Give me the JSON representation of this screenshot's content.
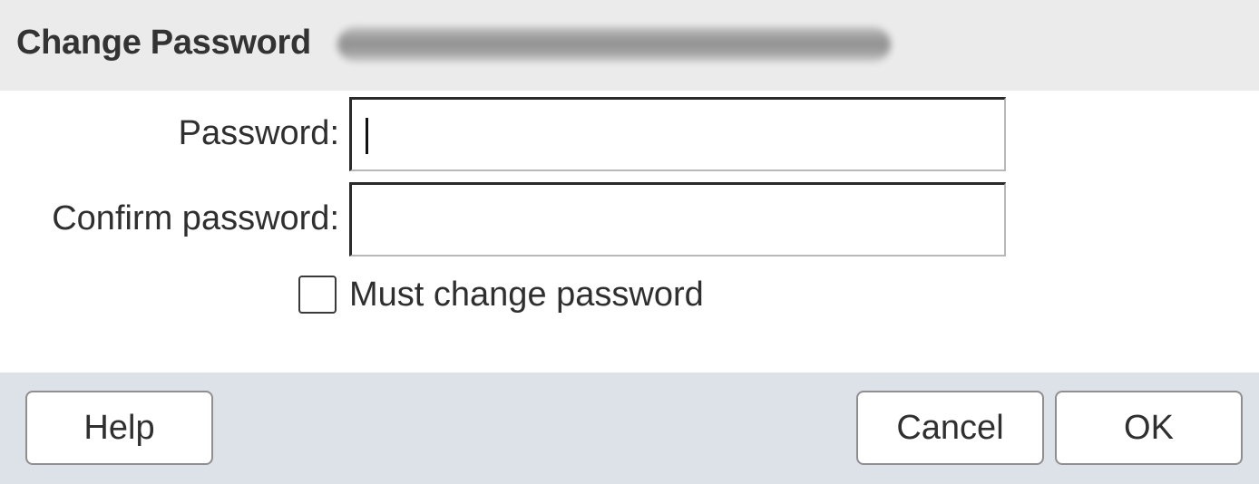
{
  "dialog": {
    "title": "Change Password",
    "title_redacted": true
  },
  "form": {
    "password": {
      "label": "Password:",
      "value": "",
      "placeholder": ""
    },
    "confirm_password": {
      "label": "Confirm password:",
      "value": "",
      "placeholder": ""
    },
    "must_change": {
      "label": "Must change password",
      "checked": false
    }
  },
  "buttons": {
    "help_label": "Help",
    "cancel_label": "Cancel",
    "ok_label": "OK"
  },
  "colors": {
    "title_bar_bg": "#ebebeb",
    "button_bar_bg": "#dde1e8",
    "input_border_dark": "#2a2a2a"
  }
}
